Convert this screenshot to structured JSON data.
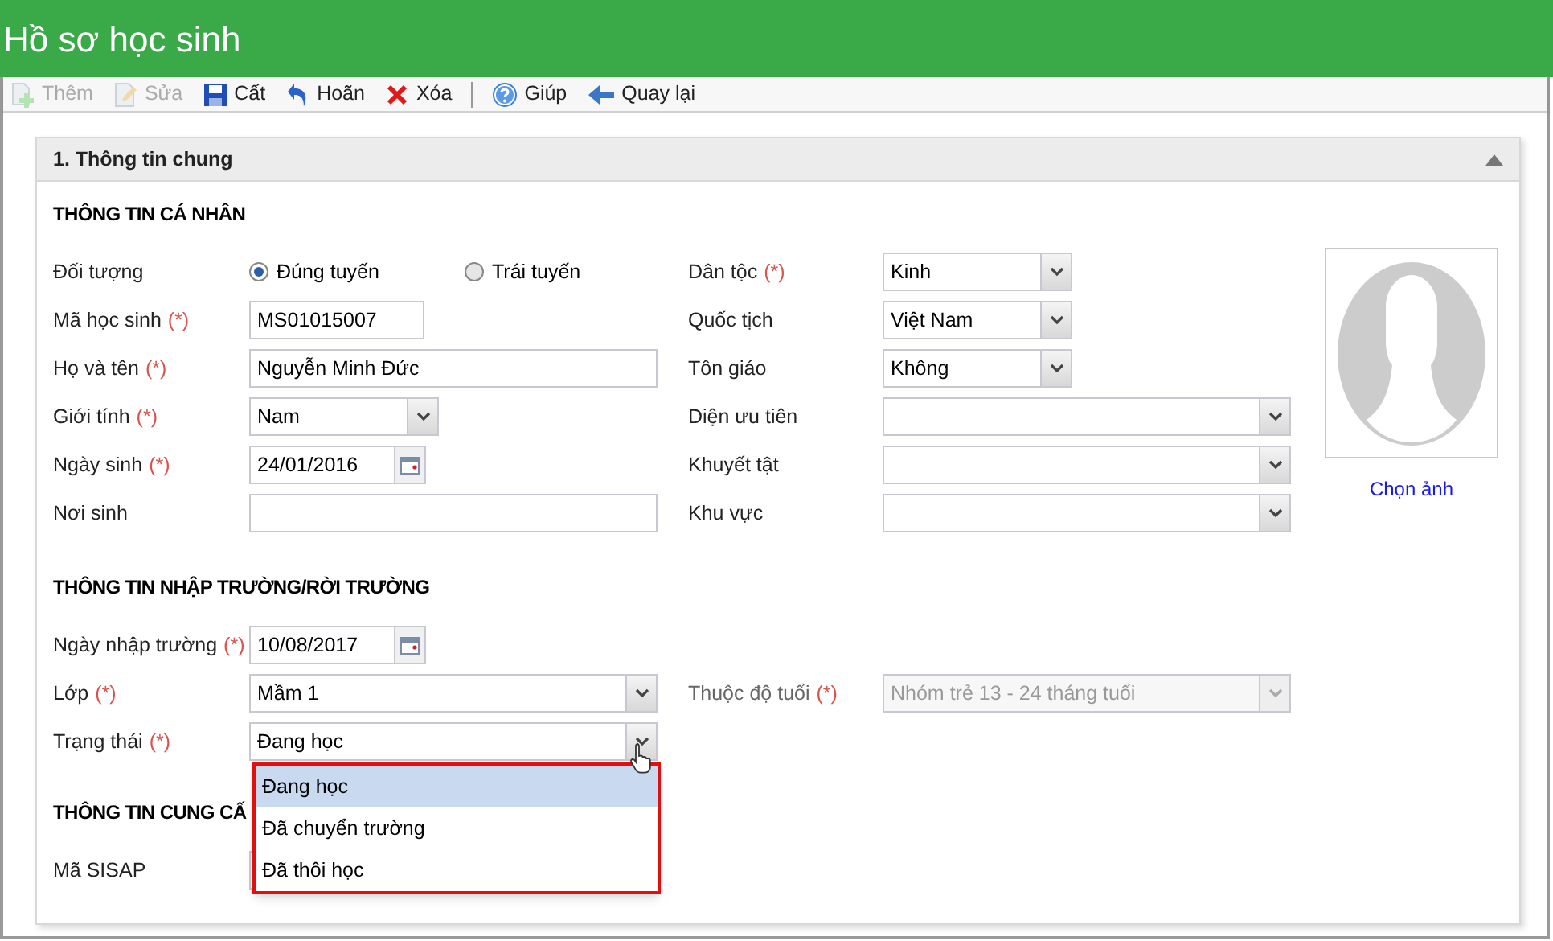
{
  "window": {
    "title": "Hồ sơ học sinh"
  },
  "toolbar": [
    {
      "label": "Thêm",
      "kind": "add",
      "disabled": true
    },
    {
      "label": "Sửa",
      "kind": "edit",
      "disabled": true
    },
    {
      "label": "Cất",
      "kind": "save",
      "disabled": false
    },
    {
      "label": "Hoãn",
      "kind": "undo",
      "disabled": false
    },
    {
      "label": "Xóa",
      "kind": "delete",
      "disabled": false
    },
    {
      "label": "Giúp",
      "kind": "help",
      "disabled": false
    },
    {
      "label": "Quay lại",
      "kind": "back",
      "disabled": false
    }
  ],
  "panel": {
    "title": "1. Thông tin chung",
    "expanded": true
  },
  "photo": {
    "link": "Chọn ảnh"
  },
  "sections": [
    {
      "title": "THÔNG TIN CÁ NHÂN",
      "rows": [
        [
          {
            "label": "Đối tượng",
            "kind": "radio",
            "options": [
              {
                "label": "Đúng tuyến",
                "selected": true
              },
              {
                "label": "Trái tuyến",
                "selected": false
              }
            ]
          },
          {
            "label": "Dân tộc",
            "mark": "(*)",
            "kind": "select",
            "value": "Kinh",
            "wide": false
          }
        ],
        [
          {
            "label": "Mã học sinh",
            "mark": "(*)",
            "kind": "text",
            "value": "MS01015007",
            "wide": false
          },
          {
            "label": "Quốc tịch",
            "kind": "select",
            "value": "Việt Nam",
            "wide": false
          }
        ],
        [
          {
            "label": "Họ và tên",
            "mark": "(*)",
            "kind": "text",
            "value": "Nguyễn Minh Đức",
            "wide": true
          },
          {
            "label": "Tôn giáo",
            "kind": "select",
            "value": "Không",
            "wide": false
          }
        ],
        [
          {
            "label": "Giới tính",
            "mark": "(*)",
            "kind": "select",
            "value": "Nam",
            "wide": false
          },
          {
            "label": "Diện ưu tiên",
            "kind": "select",
            "wide": true
          }
        ],
        [
          {
            "label": "Ngày sinh",
            "mark": "(*)",
            "kind": "date",
            "value": "24/01/2016"
          },
          {
            "label": "Khuyết tật",
            "kind": "select",
            "wide": true
          }
        ],
        [
          {
            "label": "Nơi sinh",
            "kind": "text",
            "wide": true
          },
          {
            "label": "Khu vực",
            "kind": "select",
            "wide": true
          }
        ]
      ]
    },
    {
      "title": "THÔNG TIN NHẬP TRƯỜNG/RỜI TRƯỜNG",
      "rows": [
        [
          {
            "label": "Ngày nhập trường",
            "mark": "(*)",
            "kind": "date",
            "value": "10/08/2017"
          }
        ],
        [
          {
            "label": "Lớp",
            "mark": "(*)",
            "kind": "select",
            "value": "Mầm 1",
            "wide": true
          },
          {
            "label": "Thuộc độ tuổi",
            "mark": "(*)",
            "kind": "select",
            "value": "Nhóm trẻ 13 - 24 tháng tuổi",
            "wide": true,
            "disabled": true
          }
        ],
        [
          {
            "label": "Trạng thái",
            "mark": "(*)",
            "kind": "select",
            "value": "Đang học",
            "wide": true,
            "open": true,
            "highlight": true,
            "options": [
              {
                "label": "Đang học",
                "selected": true
              },
              {
                "label": "Đã chuyển trường",
                "selected": false
              },
              {
                "label": "Đã thôi học",
                "selected": false
              }
            ]
          }
        ]
      ]
    },
    {
      "title": "THÔNG TIN CUNG CẤ",
      "rows": [
        [
          {
            "label": "Mã SISAP",
            "kind": "text",
            "wide": true
          }
        ]
      ]
    }
  ]
}
